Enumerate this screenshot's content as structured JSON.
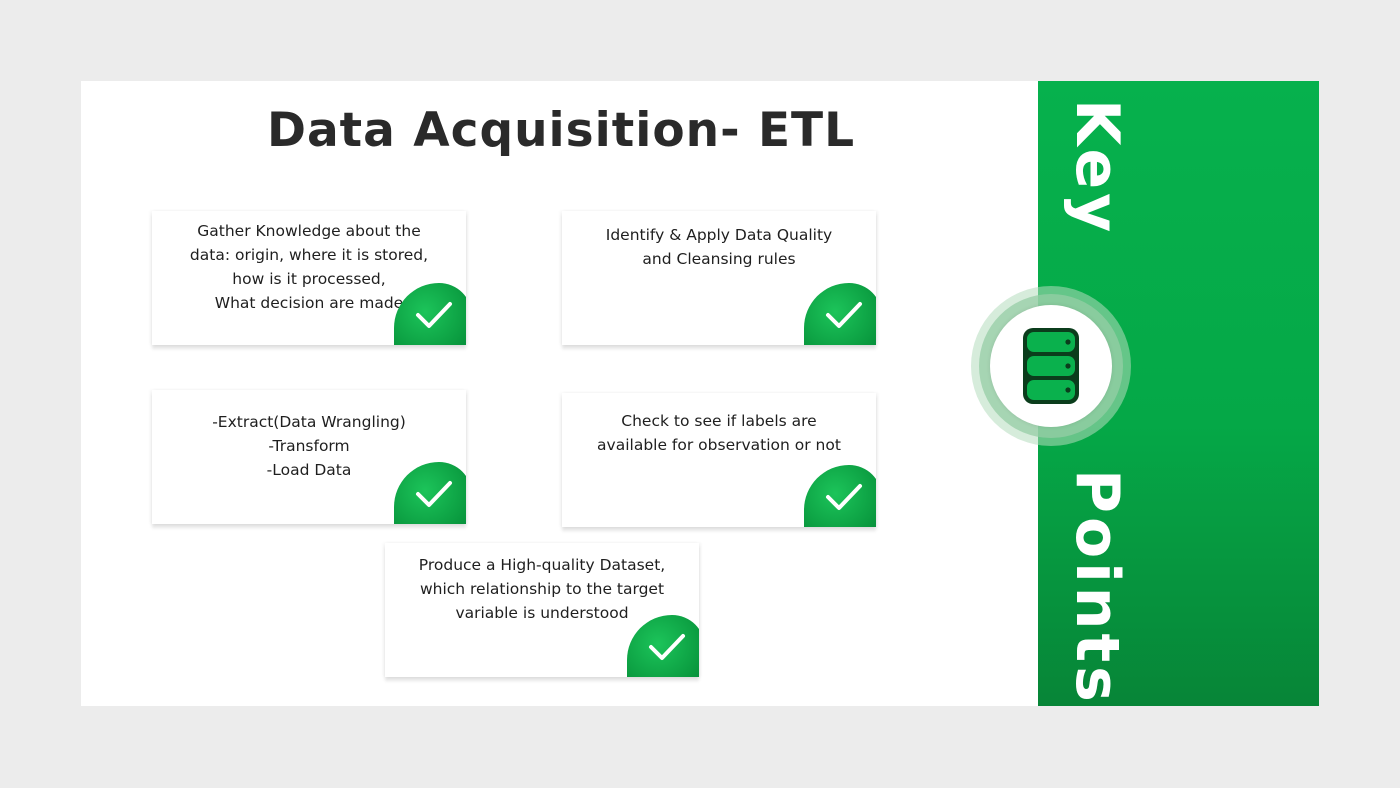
{
  "title": "Data Acquisition- ETL",
  "cards": [
    {
      "text": "Gather Knowledge about the\ndata: origin, where it is stored,\nhow is it processed,\nWhat decision are made"
    },
    {
      "text": "Identify & Apply Data Quality\nand Cleansing rules"
    },
    {
      "text": "-Extract(Data Wrangling)\n-Transform\n-Load Data"
    },
    {
      "text": "Check to see if labels are\navailable for observation or not"
    },
    {
      "text": "Produce a High-quality Dataset,\nwhich relationship to the target\nvariable is understood"
    }
  ],
  "side": {
    "word1": "Key",
    "word2": "Points",
    "icon": "database-icon"
  },
  "colors": {
    "accent": "#06b14d",
    "accent_dark": "#078537",
    "text": "#2a2a2a"
  },
  "check_icon": "checkmark-icon"
}
